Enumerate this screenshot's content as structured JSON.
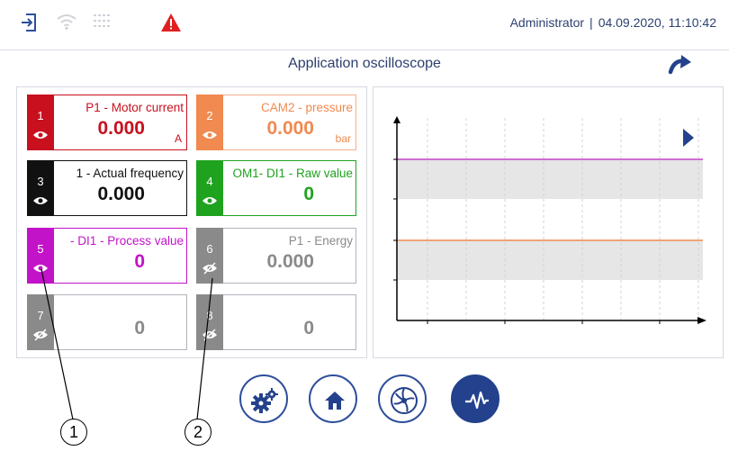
{
  "header": {
    "user": "Administrator",
    "separator": "|",
    "datetime": "04.09.2020, 11:10:42",
    "icons": [
      "login-icon",
      "wifi-icon",
      "network-icon",
      "warning-icon"
    ],
    "warning_color": "#e02020"
  },
  "title": "Application oscilloscope",
  "channels": [
    {
      "number": "1",
      "label": "P1 - Motor current",
      "value": "0.000",
      "unit": "A",
      "color": "#c8101e"
    },
    {
      "number": "2",
      "label": "CAM2 - pressure",
      "value": "0.000",
      "unit": "bar",
      "color": "#f08a50"
    },
    {
      "number": "3",
      "label": "1 - Actual frequency",
      "value": "0.000",
      "unit": "",
      "color": "#111111"
    },
    {
      "number": "4",
      "label": "OM1- DI1 - Raw value",
      "value": "0",
      "unit": "",
      "color": "#1fa31f"
    },
    {
      "number": "5",
      "label": "- DI1 - Process value",
      "value": "0",
      "unit": "",
      "color": "#c213c9"
    },
    {
      "number": "6",
      "label": "P1 - Energy",
      "value": "0.000",
      "unit": "",
      "color": "#8a8a8a"
    },
    {
      "number": "7",
      "label": "",
      "value": "0",
      "unit": "",
      "color": "#8a8a8a"
    },
    {
      "number": "8",
      "label": "",
      "value": "0",
      "unit": "",
      "color": "#8a8a8a"
    }
  ],
  "plot": {
    "traces": [
      {
        "color": "#c040c8"
      },
      {
        "color": "#f08a50"
      }
    ],
    "band_color": "#e6e6e6"
  },
  "nav": [
    "settings-icon",
    "home-icon",
    "fan-icon",
    "oscilloscope-icon"
  ],
  "callouts": [
    "1",
    "2"
  ]
}
